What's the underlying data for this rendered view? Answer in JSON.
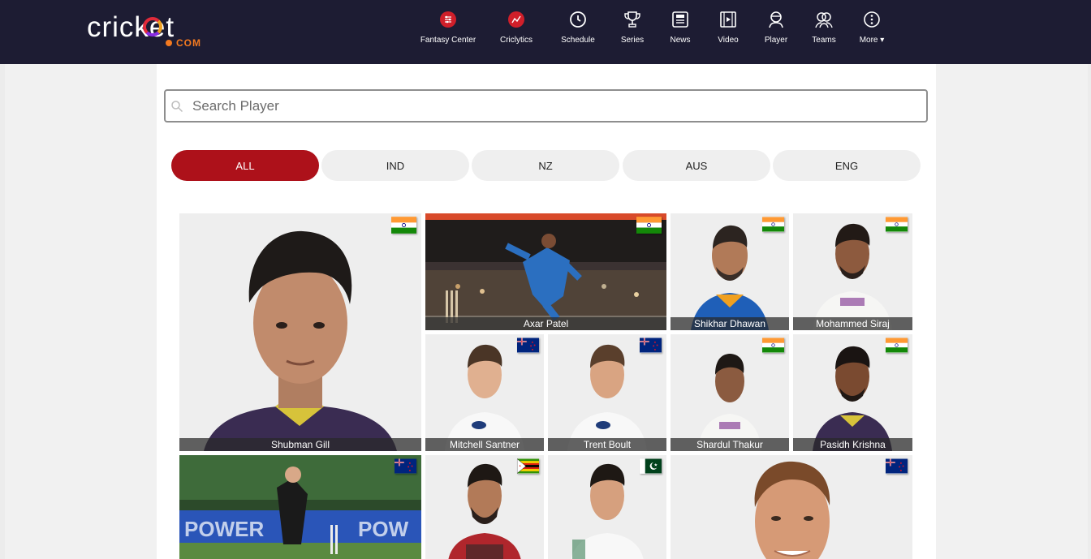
{
  "header": {
    "logo_word": "cricket",
    "logo_sub": "COM",
    "nav": [
      {
        "label": "Fantasy Center",
        "icon": "fantasy-center-icon"
      },
      {
        "label": "Criclytics",
        "icon": "criclytics-icon"
      },
      {
        "label": "Schedule",
        "icon": "clock-icon"
      },
      {
        "label": "Series",
        "icon": "trophy-icon"
      },
      {
        "label": "News",
        "icon": "news-icon"
      },
      {
        "label": "Video",
        "icon": "video-icon"
      },
      {
        "label": "Player",
        "icon": "player-icon"
      },
      {
        "label": "Teams",
        "icon": "teams-icon"
      },
      {
        "label": "More ▾",
        "icon": "more-icon"
      }
    ]
  },
  "search": {
    "placeholder": "Search Player",
    "value": ""
  },
  "filters": [
    {
      "label": "ALL",
      "active": true
    },
    {
      "label": "IND",
      "active": false
    },
    {
      "label": "NZ",
      "active": false
    },
    {
      "label": "AUS",
      "active": false
    },
    {
      "label": "ENG",
      "active": false
    }
  ],
  "players": [
    {
      "name": "Shubman Gill",
      "flag": "IND"
    },
    {
      "name": "Axar Patel",
      "flag": "IND"
    },
    {
      "name": "Shikhar Dhawan",
      "flag": "IND"
    },
    {
      "name": "Mohammed Siraj",
      "flag": "IND"
    },
    {
      "name": "Mitchell Santner",
      "flag": "NZ"
    },
    {
      "name": "Trent Boult",
      "flag": "NZ"
    },
    {
      "name": "Shardul Thakur",
      "flag": "IND"
    },
    {
      "name": "Pasidh Krishna",
      "flag": "IND"
    },
    {
      "name": "",
      "flag": "NZ"
    },
    {
      "name": "",
      "flag": "ZIM"
    },
    {
      "name": "",
      "flag": "PAK"
    },
    {
      "name": "",
      "flag": "NZ"
    }
  ],
  "colors": {
    "header_bg": "#1d1c33",
    "accent": "#ad111a",
    "logo_orange": "#f47a20"
  }
}
